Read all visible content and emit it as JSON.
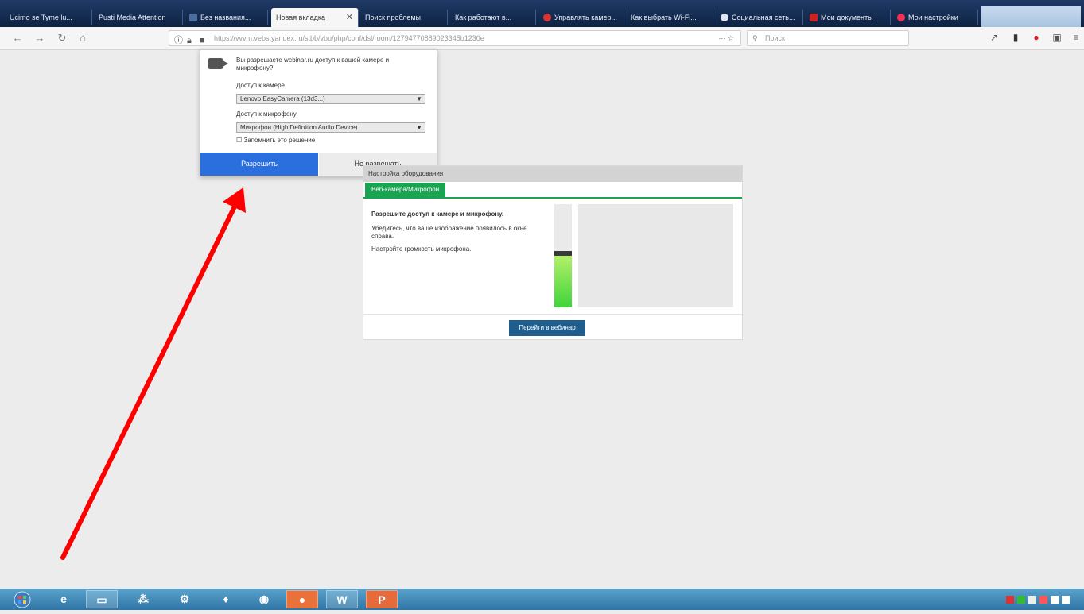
{
  "tabs": [
    {
      "label": "Ucimo se Tyme lu..."
    },
    {
      "label": "Pusti Media Attention"
    },
    {
      "label": "Без названия..."
    },
    {
      "label": "Новая вкладка"
    },
    {
      "label": "Поиск проблемы"
    },
    {
      "label": "Как работают в..."
    },
    {
      "label": "Управлять камер..."
    },
    {
      "label": "Как выбрать Wi-Fi..."
    },
    {
      "label": "Социальная сеть..."
    },
    {
      "label": "Мои документы"
    },
    {
      "label": "Мои настройки"
    }
  ],
  "url": "https://vvvm.vebs.yandex.ru/stbb/vbu/php/conf/dsl/room/12794770889023345b1230e",
  "search_placeholder": "Поиск",
  "popup": {
    "question": "Вы разрешаете webinar.ru доступ к вашей камере и микрофону?",
    "camera_label": "Доступ к камере",
    "camera_value": "Lenovo EasyCamera (13d3...)",
    "mic_label": "Доступ к микрофону",
    "mic_value": "Микрофон (High Definition Audio Device)",
    "remember_label": "Запомнить это решение",
    "allow_label": "Разрешить",
    "deny_label": "Не разрешать"
  },
  "widget": {
    "header": "Настройка оборудования",
    "tab": "Веб-камера/Микрофон",
    "text1": "Разрешите доступ к камере и микрофону.",
    "text2": "Убедитесь, что ваше изображение появилось в окне справа.",
    "text3": "Настройте громкость микрофона.",
    "button": "Перейти в вебинар",
    "mic_level": 0.52
  },
  "colors": {
    "allow": "#2b6fde",
    "green": "#1aa452",
    "widget_button": "#1f5d8c",
    "arrow": "#ff0000"
  }
}
